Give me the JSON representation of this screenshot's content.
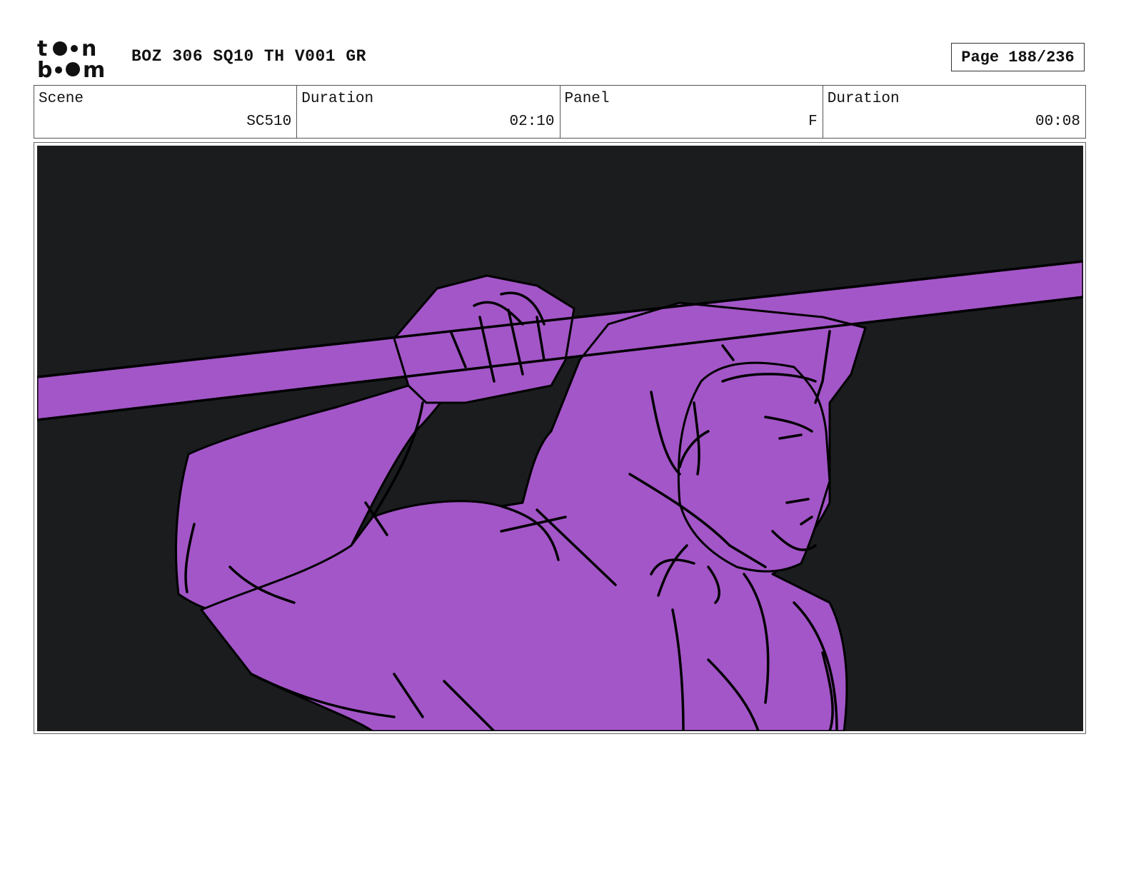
{
  "header": {
    "logo_text_top": "toon",
    "logo_text_bottom": "boom",
    "title": "BOZ 306 SQ10 TH V001 GR",
    "page_label": "Page 188/236"
  },
  "info": [
    {
      "label": "Scene",
      "value": "SC510"
    },
    {
      "label": "Duration",
      "value": "02:10"
    },
    {
      "label": "Panel",
      "value": "F"
    },
    {
      "label": "Duration",
      "value": "00:08"
    }
  ],
  "colors": {
    "background": "#1b1c1e",
    "figure": "#a356c8",
    "ink": "#000000"
  }
}
